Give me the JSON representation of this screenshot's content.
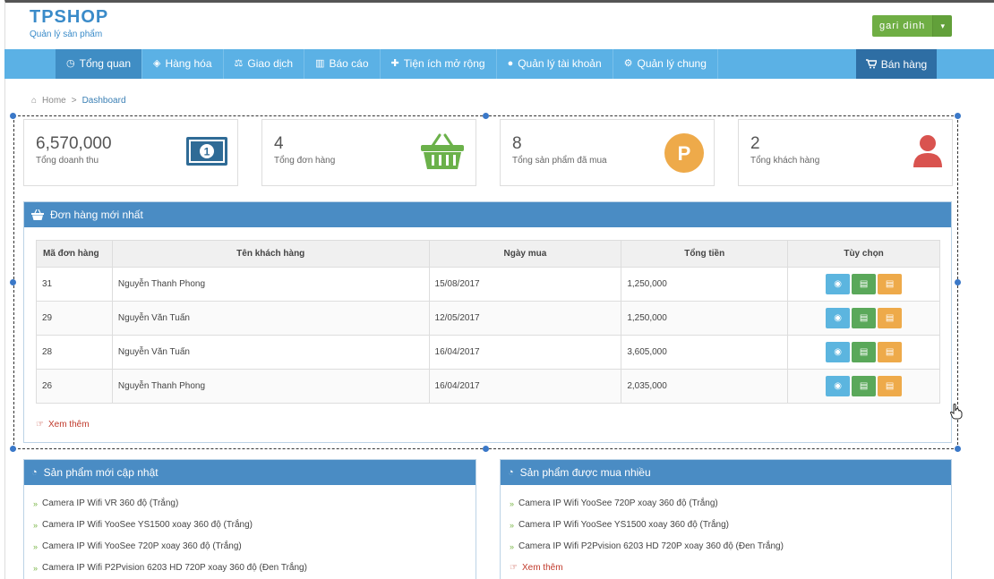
{
  "brand": {
    "title": "TPSHOP",
    "subtitle": "Quản lý sản phẩm"
  },
  "user": {
    "name": "gari dinh",
    "caret": "▾"
  },
  "nav": {
    "items": [
      {
        "label": "Tổng quan",
        "icon": "dashboard-icon",
        "glyph": "◷",
        "active": true
      },
      {
        "label": "Hàng hóa",
        "icon": "cube-icon",
        "glyph": "◈"
      },
      {
        "label": "Giao dịch",
        "icon": "balance-icon",
        "glyph": "⚖"
      },
      {
        "label": "Báo cáo",
        "icon": "bar-chart-icon",
        "glyph": "▥"
      },
      {
        "label": "Tiện ích mở rộng",
        "icon": "puzzle-icon",
        "glyph": "✚"
      },
      {
        "label": "Quản lý tài khoản",
        "icon": "user-icon",
        "glyph": "●"
      },
      {
        "label": "Quản lý chung",
        "icon": "gear-icon",
        "glyph": "⚙"
      }
    ],
    "sell_label": "Bán hàng",
    "sell_icon": "cart-icon"
  },
  "breadcrumb": {
    "home": "Home",
    "separator": ">",
    "current": "Dashboard"
  },
  "stats": [
    {
      "value": "6,570,000",
      "label": "Tổng doanh thu",
      "icon": "money-icon"
    },
    {
      "value": "4",
      "label": "Tổng đơn hàng",
      "icon": "basket-icon"
    },
    {
      "value": "8",
      "label": "Tổng sản phẩm đã mua",
      "icon": "p-coin-icon",
      "coin_letter": "P"
    },
    {
      "value": "2",
      "label": "Tổng khách hàng",
      "icon": "user-icon"
    }
  ],
  "orders": {
    "title": "Đơn hàng mới nhất",
    "headers": [
      "Mã đơn hàng",
      "Tên khách hàng",
      "Ngày mua",
      "Tổng tiền",
      "Tùy chọn"
    ],
    "rows": [
      {
        "id": "31",
        "customer": "Nguyễn Thanh Phong",
        "date": "15/08/2017",
        "total": "1,250,000"
      },
      {
        "id": "29",
        "customer": "Nguyễn Văn Tuấn",
        "date": "12/05/2017",
        "total": "1,250,000"
      },
      {
        "id": "28",
        "customer": "Nguyễn Văn Tuấn",
        "date": "16/04/2017",
        "total": "3,605,000"
      },
      {
        "id": "26",
        "customer": "Nguyễn Thanh Phong",
        "date": "16/04/2017",
        "total": "2,035,000"
      }
    ],
    "more": "Xem thêm"
  },
  "new_products": {
    "title": "Sản phẩm mới cập nhật",
    "items": [
      "Camera IP Wifi VR 360 độ (Trắng)",
      "Camera IP Wifi YooSee YS1500 xoay 360 độ (Trắng)",
      "Camera IP Wifi YooSee 720P xoay 360 độ (Trắng)",
      "Camera IP Wifi P2Pvision 6203 HD 720P xoay 360 độ (Đen Trắng)"
    ]
  },
  "popular_products": {
    "title": "Sản phẩm được mua nhiều",
    "items": [
      "Camera IP Wifi YooSee 720P xoay 360 độ (Trắng)",
      "Camera IP Wifi YooSee YS1500 xoay 360 độ (Trắng)",
      "Camera IP Wifi P2Pvision 6203 HD 720P xoay 360 độ (Đen Trắng)"
    ],
    "more": "Xem thêm"
  },
  "colors": {
    "nav": "#5bb1e5",
    "panel_head": "#4a8cc4",
    "accent_green": "#6fae44",
    "money": "#2f6b96",
    "basket": "#6bb14a",
    "coin": "#eeaa4a",
    "user": "#d9534f"
  }
}
